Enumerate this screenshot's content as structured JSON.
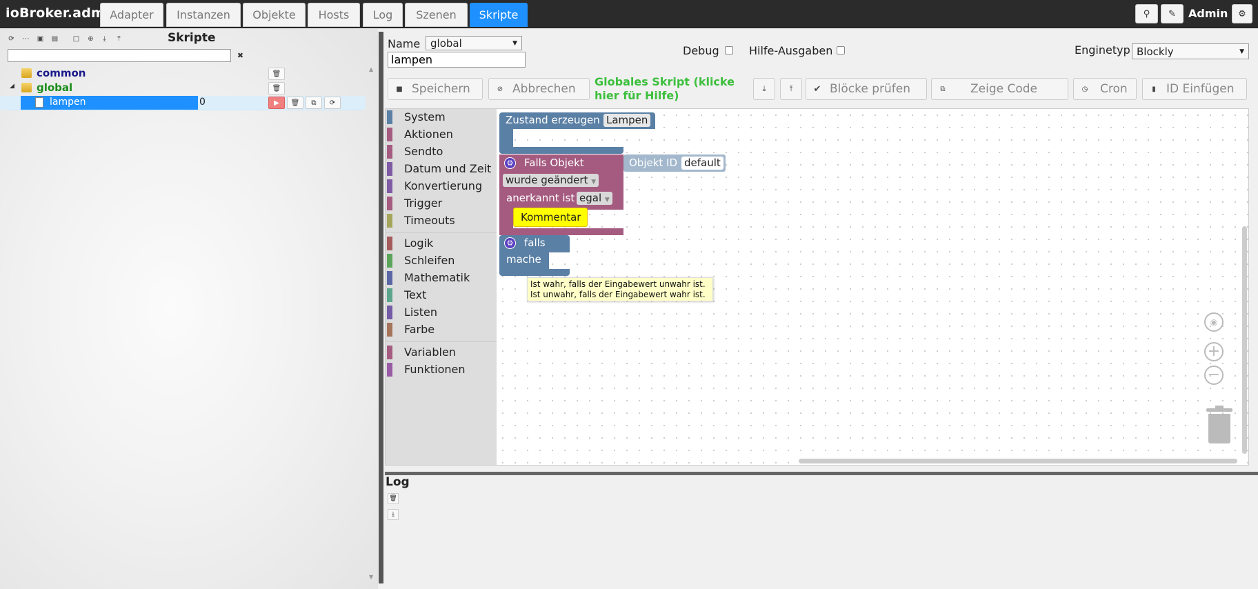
{
  "app": {
    "title": "ioBroker.admin"
  },
  "tabs": [
    {
      "label": "Adapter"
    },
    {
      "label": "Instanzen"
    },
    {
      "label": "Objekte"
    },
    {
      "label": "Hosts"
    },
    {
      "label": "Log"
    },
    {
      "label": "Szenen"
    },
    {
      "label": "Skripte",
      "active": true
    }
  ],
  "topbar": {
    "user": "Admin",
    "icons": [
      "search-icon",
      "pencil-icon",
      "gear-icon"
    ]
  },
  "left": {
    "title": "Skripte",
    "filter_value": "",
    "tree": [
      {
        "label": "common",
        "type": "folder",
        "color": "#1a1a8c"
      },
      {
        "label": "global",
        "type": "folder",
        "color": "#1a8c1a"
      },
      {
        "label": "lampen",
        "type": "script",
        "value": "0",
        "selected": true
      }
    ]
  },
  "header": {
    "name_label": "Name",
    "name_select": "global",
    "name_input": "lampen",
    "debug_label": "Debug",
    "help_label": "Hilfe-Ausgaben",
    "engine_label": "Enginetyp",
    "engine_select": "Blockly"
  },
  "toolbar": {
    "save": "Speichern",
    "cancel": "Abbrechen",
    "help_text": "Globales Skript (klicke hier für Hilfe)",
    "check": "Blöcke prüfen",
    "show_code": "Zeige Code",
    "cron": "Cron",
    "insert_id": "ID Einfügen"
  },
  "toolbox": {
    "categories": [
      {
        "label": "System",
        "color": "#5b80a5"
      },
      {
        "label": "Aktionen",
        "color": "#a55b80"
      },
      {
        "label": "Sendto",
        "color": "#a55b80"
      },
      {
        "label": "Datum und Zeit",
        "color": "#805ba5"
      },
      {
        "label": "Konvertierung",
        "color": "#805ba5"
      },
      {
        "label": "Trigger",
        "color": "#a55b80"
      },
      {
        "label": "Timeouts",
        "color": "#a5a55b"
      },
      {
        "label": "Logik",
        "color": "#a55b5b"
      },
      {
        "label": "Schleifen",
        "color": "#5ba55b"
      },
      {
        "label": "Mathematik",
        "color": "#5b67a5"
      },
      {
        "label": "Text",
        "color": "#5ba58c"
      },
      {
        "label": "Listen",
        "color": "#745ba5"
      },
      {
        "label": "Farbe",
        "color": "#a5745b"
      },
      {
        "label": "Variablen",
        "color": "#a55b80"
      },
      {
        "label": "Funktionen",
        "color": "#995ba5"
      }
    ]
  },
  "blocks": {
    "state_create": "Zustand erzeugen",
    "state_name": "Lampen",
    "trigger_label": "Falls Objekt",
    "object_id_label": "Objekt ID",
    "object_id_value": "default",
    "changed": "wurde geändert",
    "ack_label": "anerkannt ist",
    "ack_value": "egal",
    "comment": "Kommentar",
    "if_label": "falls",
    "do_label": "mache"
  },
  "tooltip": {
    "line1": "Ist wahr, falls der Eingabewert unwahr ist.",
    "line2": "Ist unwahr, falls der Eingabewert wahr ist."
  },
  "log": {
    "title": "Log"
  }
}
